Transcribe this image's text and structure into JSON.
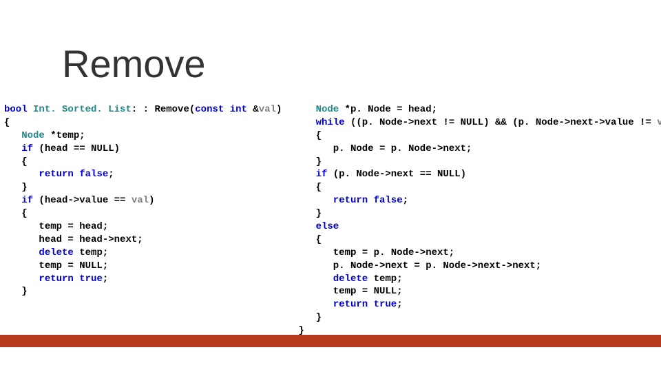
{
  "title": "Remove",
  "code": {
    "left": [
      {
        "indent": 0,
        "runs": [
          {
            "c": "k",
            "t": "bool"
          },
          {
            "c": "",
            "t": " "
          },
          {
            "c": "t",
            "t": "Int. Sorted. List"
          },
          {
            "c": "",
            "t": ": : Remove("
          },
          {
            "c": "k",
            "t": "const"
          },
          {
            "c": "",
            "t": " "
          },
          {
            "c": "k",
            "t": "int"
          },
          {
            "c": "",
            "t": " &"
          },
          {
            "c": "p",
            "t": "val"
          },
          {
            "c": "",
            "t": ")"
          }
        ]
      },
      {
        "indent": 0,
        "runs": [
          {
            "c": "",
            "t": "{"
          }
        ]
      },
      {
        "indent": 1,
        "runs": [
          {
            "c": "t",
            "t": "Node"
          },
          {
            "c": "",
            "t": " *temp;"
          }
        ]
      },
      {
        "indent": 1,
        "runs": [
          {
            "c": "k",
            "t": "if"
          },
          {
            "c": "",
            "t": " (head == NULL)"
          }
        ]
      },
      {
        "indent": 1,
        "runs": [
          {
            "c": "",
            "t": "{"
          }
        ]
      },
      {
        "indent": 2,
        "runs": [
          {
            "c": "k",
            "t": "return"
          },
          {
            "c": "",
            "t": " "
          },
          {
            "c": "k",
            "t": "false"
          },
          {
            "c": "",
            "t": ";"
          }
        ]
      },
      {
        "indent": 1,
        "runs": [
          {
            "c": "",
            "t": "}"
          }
        ]
      },
      {
        "indent": 1,
        "runs": [
          {
            "c": "k",
            "t": "if"
          },
          {
            "c": "",
            "t": " (head->value == "
          },
          {
            "c": "p",
            "t": "val"
          },
          {
            "c": "",
            "t": ")"
          }
        ]
      },
      {
        "indent": 1,
        "runs": [
          {
            "c": "",
            "t": "{"
          }
        ]
      },
      {
        "indent": 2,
        "runs": [
          {
            "c": "",
            "t": "temp = head;"
          }
        ]
      },
      {
        "indent": 2,
        "runs": [
          {
            "c": "",
            "t": "head = head->next;"
          }
        ]
      },
      {
        "indent": 2,
        "runs": [
          {
            "c": "k",
            "t": "delete"
          },
          {
            "c": "",
            "t": " temp;"
          }
        ]
      },
      {
        "indent": 2,
        "runs": [
          {
            "c": "",
            "t": "temp = NULL;"
          }
        ]
      },
      {
        "indent": 2,
        "runs": [
          {
            "c": "k",
            "t": "return"
          },
          {
            "c": "",
            "t": " "
          },
          {
            "c": "k",
            "t": "true"
          },
          {
            "c": "",
            "t": ";"
          }
        ]
      },
      {
        "indent": 1,
        "runs": [
          {
            "c": "",
            "t": "}"
          }
        ]
      }
    ],
    "right": [
      {
        "indent": 1,
        "runs": [
          {
            "c": "t",
            "t": "Node"
          },
          {
            "c": "",
            "t": " *p. Node = head;"
          }
        ]
      },
      {
        "indent": 1,
        "runs": [
          {
            "c": "k",
            "t": "while"
          },
          {
            "c": "",
            "t": " ((p. Node->next != NULL) && (p. Node->next->value != "
          },
          {
            "c": "p",
            "t": "val"
          },
          {
            "c": "",
            "t": "))"
          }
        ]
      },
      {
        "indent": 1,
        "runs": [
          {
            "c": "",
            "t": "{"
          }
        ]
      },
      {
        "indent": 2,
        "runs": [
          {
            "c": "",
            "t": "p. Node = p. Node->next;"
          }
        ]
      },
      {
        "indent": 1,
        "runs": [
          {
            "c": "",
            "t": "}"
          }
        ]
      },
      {
        "indent": 1,
        "runs": [
          {
            "c": "k",
            "t": "if"
          },
          {
            "c": "",
            "t": " (p. Node->next == NULL)"
          }
        ]
      },
      {
        "indent": 1,
        "runs": [
          {
            "c": "",
            "t": "{"
          }
        ]
      },
      {
        "indent": 2,
        "runs": [
          {
            "c": "k",
            "t": "return"
          },
          {
            "c": "",
            "t": " "
          },
          {
            "c": "k",
            "t": "false"
          },
          {
            "c": "",
            "t": ";"
          }
        ]
      },
      {
        "indent": 1,
        "runs": [
          {
            "c": "",
            "t": "}"
          }
        ]
      },
      {
        "indent": 1,
        "runs": [
          {
            "c": "k",
            "t": "else"
          }
        ]
      },
      {
        "indent": 1,
        "runs": [
          {
            "c": "",
            "t": "{"
          }
        ]
      },
      {
        "indent": 2,
        "runs": [
          {
            "c": "",
            "t": "temp = p. Node->next;"
          }
        ]
      },
      {
        "indent": 2,
        "runs": [
          {
            "c": "",
            "t": "p. Node->next = p. Node->next->next;"
          }
        ]
      },
      {
        "indent": 2,
        "runs": [
          {
            "c": "k",
            "t": "delete"
          },
          {
            "c": "",
            "t": " temp;"
          }
        ]
      },
      {
        "indent": 2,
        "runs": [
          {
            "c": "",
            "t": "temp = NULL;"
          }
        ]
      },
      {
        "indent": 2,
        "runs": [
          {
            "c": "k",
            "t": "return"
          },
          {
            "c": "",
            "t": " "
          },
          {
            "c": "k",
            "t": "true"
          },
          {
            "c": "",
            "t": ";"
          }
        ]
      },
      {
        "indent": 1,
        "runs": [
          {
            "c": "",
            "t": "}"
          }
        ]
      },
      {
        "indent": 0,
        "runs": [
          {
            "c": "",
            "t": "}"
          }
        ]
      }
    ]
  }
}
